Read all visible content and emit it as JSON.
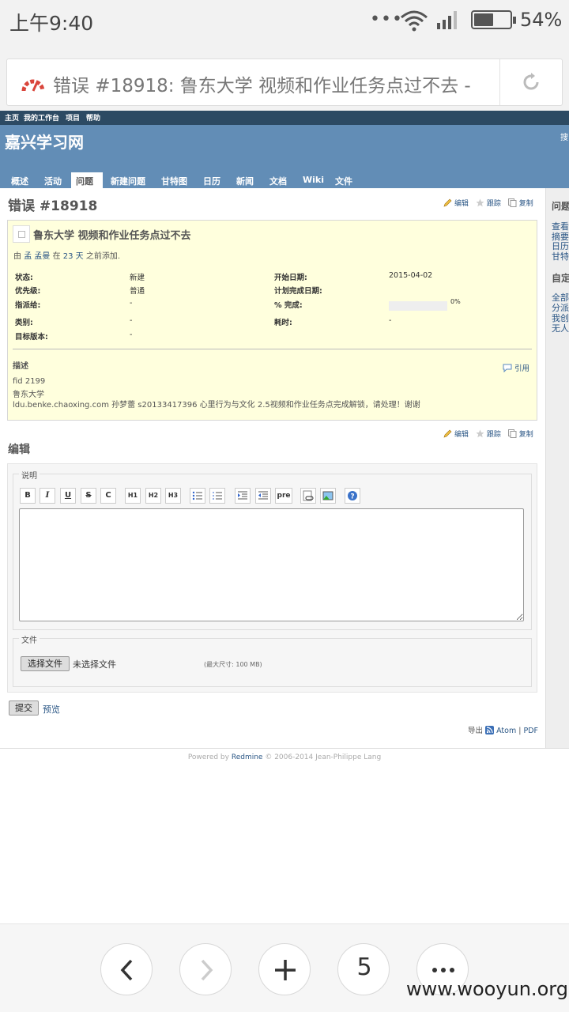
{
  "status_bar": {
    "time": "上午9:40",
    "battery_pct": "54%",
    "battery_level": 0.54
  },
  "address_bar": {
    "url_text": "错误 #18918: 鲁东大学 视频和作业任务点过不去 -"
  },
  "top_menu": [
    "主页",
    "我的工作台",
    "项目",
    "帮助"
  ],
  "header": {
    "site_title": "嘉兴学习网",
    "search_label": "搜",
    "tabs": [
      "概述",
      "活动",
      "问题",
      "新建问题",
      "甘特图",
      "日历",
      "新闻",
      "文档",
      "Wiki",
      "文件"
    ],
    "selected_tab": "问题"
  },
  "issue": {
    "heading": "错误 #18918",
    "actions": {
      "edit": "编辑",
      "watch": "跟踪",
      "copy": "复制"
    },
    "subject": "鲁东大学 视频和作业任务点过不去",
    "author_line": {
      "prefix": "由",
      "author": "孟 孟曼",
      "in": "在",
      "age": "23 天",
      "suffix": "之前添加."
    },
    "attributes": {
      "status_label": "状态:",
      "status": "新建",
      "priority_label": "优先级:",
      "priority": "普通",
      "assignee_label": "指派给:",
      "assignee": "-",
      "category_label": "类别:",
      "category": "-",
      "version_label": "目标版本:",
      "version": "-",
      "start_label": "开始日期:",
      "start": "2015-04-02",
      "due_label": "计划完成日期:",
      "due": "",
      "done_label": "% 完成:",
      "done": "0%",
      "done_value": 0,
      "spent_label": "耗时:",
      "spent": "-"
    },
    "description_label": "描述",
    "quote_label": "引用",
    "description_lines": [
      "fid 2199",
      "鲁东大学",
      "ldu.benke.chaoxing.com 孙梦蕾 s20133417396 心里行为与文化 2.5视频和作业任务点完成解锁，请处理！谢谢"
    ]
  },
  "edit_form": {
    "heading": "编辑",
    "notes_legend": "说明",
    "toolbar": [
      "B",
      "I",
      "U",
      "S",
      "C",
      "H1",
      "H2",
      "H3",
      "ul",
      "ol",
      "indent",
      "outdent",
      "pre",
      "link",
      "img",
      "help"
    ],
    "notes_value": "",
    "files_legend": "文件",
    "choose_file": "选择文件",
    "no_file": "未选择文件",
    "max_size": "(最大尺寸: 100 MB)",
    "submit": "提交",
    "preview": "预览"
  },
  "export": {
    "label": "导出",
    "atom": "Atom",
    "sep": "|",
    "pdf": "PDF"
  },
  "sidebar": {
    "heading1": "问题",
    "links1": [
      "查看",
      "摘要",
      "日历",
      "甘特"
    ],
    "heading2": "自定",
    "links2": [
      "全部",
      "分派",
      "我创",
      "无人"
    ]
  },
  "footer": {
    "powered": "Powered by",
    "redmine": "Redmine",
    "copy": "© 2006-2014 Jean-Philippe Lang"
  },
  "bottom_bar": {
    "tab_count": "5"
  },
  "watermark": "www.wooyun.org"
}
